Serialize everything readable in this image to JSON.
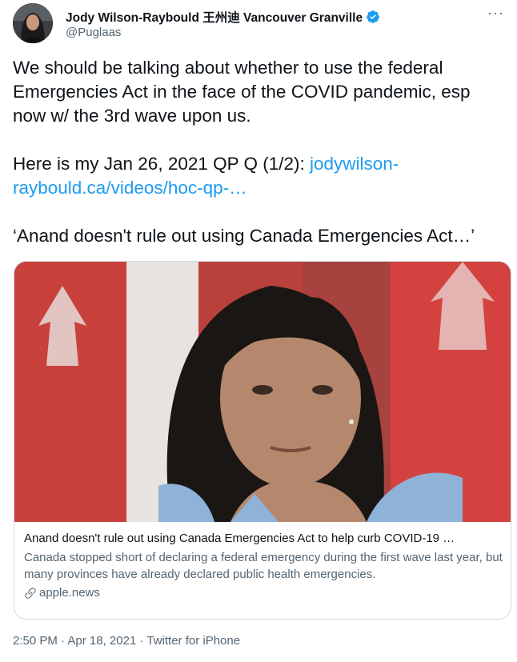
{
  "author": {
    "display_name": "Jody Wilson-Raybould 王州迪 Vancouver Granville",
    "handle": "@Puglaas"
  },
  "tweet": {
    "line1": "We should be talking about whether to use the federal Emergencies Act in the face of the COVID pandemic, esp now w/ the 3rd wave upon us.",
    "line2_prefix": "Here is my Jan 26, 2021 QP Q (1/2): ",
    "link_text": "jodywilson-raybould.ca/videos/hoc-qp-…",
    "quote": "‘Anand doesn't rule out using Canada Emergencies Act…’"
  },
  "card": {
    "title": "Anand doesn't rule out using Canada Emergencies Act to help curb COVID-19 …",
    "description": "Canada stopped short of declaring a federal emergency during the first wave last year, but many provinces have already declared public health emergencies.",
    "domain": "apple.news"
  },
  "meta": {
    "time": "2:50 PM",
    "sep1": " · ",
    "date": "Apr 18, 2021",
    "sep2": " · ",
    "source": "Twitter for iPhone"
  },
  "icons": {
    "verified": "verified-badge-icon",
    "more": "more-options-icon",
    "link": "link-icon"
  },
  "colors": {
    "link": "#1d9bf0",
    "secondary_text": "#536471",
    "verified": "#1d9bf0",
    "border": "#cfd9de"
  }
}
